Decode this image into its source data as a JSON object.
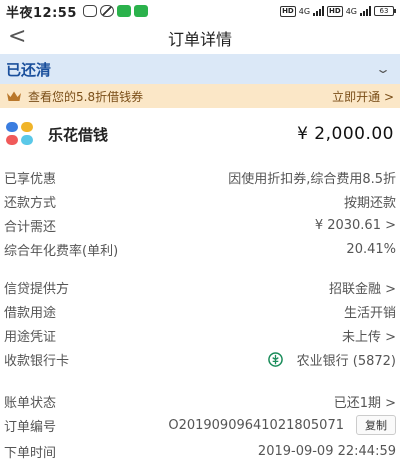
{
  "status_bar": {
    "time": "半夜12:55",
    "net_label_1": "4G",
    "net_label_2": "4G",
    "hd_label": "HD",
    "battery": "63"
  },
  "nav": {
    "back_icon": "chevron-left-icon",
    "title": "订单详情"
  },
  "status_banner": {
    "label": "已还清"
  },
  "promo": {
    "text": "查看您的5.8折借钱券",
    "cta": "立即开通 >"
  },
  "product": {
    "name": "乐花借钱",
    "amount": "¥ 2,000.00"
  },
  "details": {
    "discount": {
      "label": "已享优惠",
      "value": "因使用折扣券,综合费用8.5折"
    },
    "repay_method": {
      "label": "还款方式",
      "value": "按期还款"
    },
    "total_due": {
      "label": "合计需还",
      "value": "¥ 2030.61 >"
    },
    "apr": {
      "label": "综合年化费率(单利)",
      "value": "20.41%"
    },
    "lender": {
      "label": "信贷提供方",
      "value": "招联金融 >"
    },
    "purpose": {
      "label": "借款用途",
      "value": "生活开销"
    },
    "proof": {
      "label": "用途凭证",
      "value": "未上传 >"
    },
    "bank": {
      "label": "收款银行卡",
      "value": "农业银行 (5872)"
    },
    "bill_status": {
      "label": "账单状态",
      "value": "已还1期 >"
    },
    "order_no": {
      "label": "订单编号",
      "value": "O20190909641021805071",
      "copy_label": "复制"
    },
    "order_time": {
      "label": "下单时间",
      "value": "2019-09-09  22:44:59"
    }
  },
  "colors": {
    "banner_bg": "#dbe8f7",
    "banner_text": "#1a4f9c",
    "promo_bg": "#fbe7c7",
    "promo_text": "#7a4e18",
    "bank_green": "#1a8c5a"
  }
}
